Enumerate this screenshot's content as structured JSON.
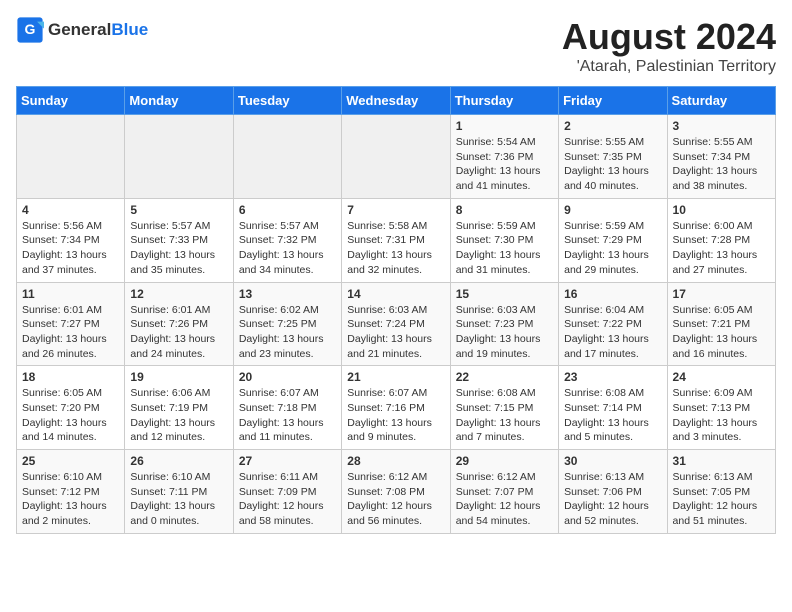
{
  "header": {
    "logo_general": "General",
    "logo_blue": "Blue",
    "title": "August 2024",
    "subtitle": "'Atarah, Palestinian Territory"
  },
  "weekdays": [
    "Sunday",
    "Monday",
    "Tuesday",
    "Wednesday",
    "Thursday",
    "Friday",
    "Saturday"
  ],
  "weeks": [
    [
      {
        "day": "",
        "info": ""
      },
      {
        "day": "",
        "info": ""
      },
      {
        "day": "",
        "info": ""
      },
      {
        "day": "",
        "info": ""
      },
      {
        "day": "1",
        "info": "Sunrise: 5:54 AM\nSunset: 7:36 PM\nDaylight: 13 hours and 41 minutes."
      },
      {
        "day": "2",
        "info": "Sunrise: 5:55 AM\nSunset: 7:35 PM\nDaylight: 13 hours and 40 minutes."
      },
      {
        "day": "3",
        "info": "Sunrise: 5:55 AM\nSunset: 7:34 PM\nDaylight: 13 hours and 38 minutes."
      }
    ],
    [
      {
        "day": "4",
        "info": "Sunrise: 5:56 AM\nSunset: 7:34 PM\nDaylight: 13 hours and 37 minutes."
      },
      {
        "day": "5",
        "info": "Sunrise: 5:57 AM\nSunset: 7:33 PM\nDaylight: 13 hours and 35 minutes."
      },
      {
        "day": "6",
        "info": "Sunrise: 5:57 AM\nSunset: 7:32 PM\nDaylight: 13 hours and 34 minutes."
      },
      {
        "day": "7",
        "info": "Sunrise: 5:58 AM\nSunset: 7:31 PM\nDaylight: 13 hours and 32 minutes."
      },
      {
        "day": "8",
        "info": "Sunrise: 5:59 AM\nSunset: 7:30 PM\nDaylight: 13 hours and 31 minutes."
      },
      {
        "day": "9",
        "info": "Sunrise: 5:59 AM\nSunset: 7:29 PM\nDaylight: 13 hours and 29 minutes."
      },
      {
        "day": "10",
        "info": "Sunrise: 6:00 AM\nSunset: 7:28 PM\nDaylight: 13 hours and 27 minutes."
      }
    ],
    [
      {
        "day": "11",
        "info": "Sunrise: 6:01 AM\nSunset: 7:27 PM\nDaylight: 13 hours and 26 minutes."
      },
      {
        "day": "12",
        "info": "Sunrise: 6:01 AM\nSunset: 7:26 PM\nDaylight: 13 hours and 24 minutes."
      },
      {
        "day": "13",
        "info": "Sunrise: 6:02 AM\nSunset: 7:25 PM\nDaylight: 13 hours and 23 minutes."
      },
      {
        "day": "14",
        "info": "Sunrise: 6:03 AM\nSunset: 7:24 PM\nDaylight: 13 hours and 21 minutes."
      },
      {
        "day": "15",
        "info": "Sunrise: 6:03 AM\nSunset: 7:23 PM\nDaylight: 13 hours and 19 minutes."
      },
      {
        "day": "16",
        "info": "Sunrise: 6:04 AM\nSunset: 7:22 PM\nDaylight: 13 hours and 17 minutes."
      },
      {
        "day": "17",
        "info": "Sunrise: 6:05 AM\nSunset: 7:21 PM\nDaylight: 13 hours and 16 minutes."
      }
    ],
    [
      {
        "day": "18",
        "info": "Sunrise: 6:05 AM\nSunset: 7:20 PM\nDaylight: 13 hours and 14 minutes."
      },
      {
        "day": "19",
        "info": "Sunrise: 6:06 AM\nSunset: 7:19 PM\nDaylight: 13 hours and 12 minutes."
      },
      {
        "day": "20",
        "info": "Sunrise: 6:07 AM\nSunset: 7:18 PM\nDaylight: 13 hours and 11 minutes."
      },
      {
        "day": "21",
        "info": "Sunrise: 6:07 AM\nSunset: 7:16 PM\nDaylight: 13 hours and 9 minutes."
      },
      {
        "day": "22",
        "info": "Sunrise: 6:08 AM\nSunset: 7:15 PM\nDaylight: 13 hours and 7 minutes."
      },
      {
        "day": "23",
        "info": "Sunrise: 6:08 AM\nSunset: 7:14 PM\nDaylight: 13 hours and 5 minutes."
      },
      {
        "day": "24",
        "info": "Sunrise: 6:09 AM\nSunset: 7:13 PM\nDaylight: 13 hours and 3 minutes."
      }
    ],
    [
      {
        "day": "25",
        "info": "Sunrise: 6:10 AM\nSunset: 7:12 PM\nDaylight: 13 hours and 2 minutes."
      },
      {
        "day": "26",
        "info": "Sunrise: 6:10 AM\nSunset: 7:11 PM\nDaylight: 13 hours and 0 minutes."
      },
      {
        "day": "27",
        "info": "Sunrise: 6:11 AM\nSunset: 7:09 PM\nDaylight: 12 hours and 58 minutes."
      },
      {
        "day": "28",
        "info": "Sunrise: 6:12 AM\nSunset: 7:08 PM\nDaylight: 12 hours and 56 minutes."
      },
      {
        "day": "29",
        "info": "Sunrise: 6:12 AM\nSunset: 7:07 PM\nDaylight: 12 hours and 54 minutes."
      },
      {
        "day": "30",
        "info": "Sunrise: 6:13 AM\nSunset: 7:06 PM\nDaylight: 12 hours and 52 minutes."
      },
      {
        "day": "31",
        "info": "Sunrise: 6:13 AM\nSunset: 7:05 PM\nDaylight: 12 hours and 51 minutes."
      }
    ]
  ]
}
